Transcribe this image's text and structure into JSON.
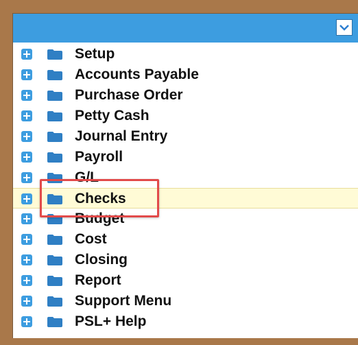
{
  "header": {
    "dropdown_icon": "chevron-down-icon",
    "background_color": "#3d9de0"
  },
  "tree": {
    "expand_icon": "plus-box-icon",
    "folder_icon": "folder-icon",
    "items": [
      {
        "label": "Setup"
      },
      {
        "label": "Accounts Payable"
      },
      {
        "label": "Purchase Order"
      },
      {
        "label": "Petty Cash"
      },
      {
        "label": "Journal Entry"
      },
      {
        "label": "Payroll"
      },
      {
        "label": "G/L"
      },
      {
        "label": "Checks",
        "highlighted": true
      },
      {
        "label": "Budget"
      },
      {
        "label": "Cost"
      },
      {
        "label": "Closing"
      },
      {
        "label": "Report"
      },
      {
        "label": "Support Menu"
      },
      {
        "label": "PSL+ Help"
      }
    ]
  },
  "highlight": {
    "row_color": "#fffbd6",
    "callout_color": "#e24a4a"
  }
}
